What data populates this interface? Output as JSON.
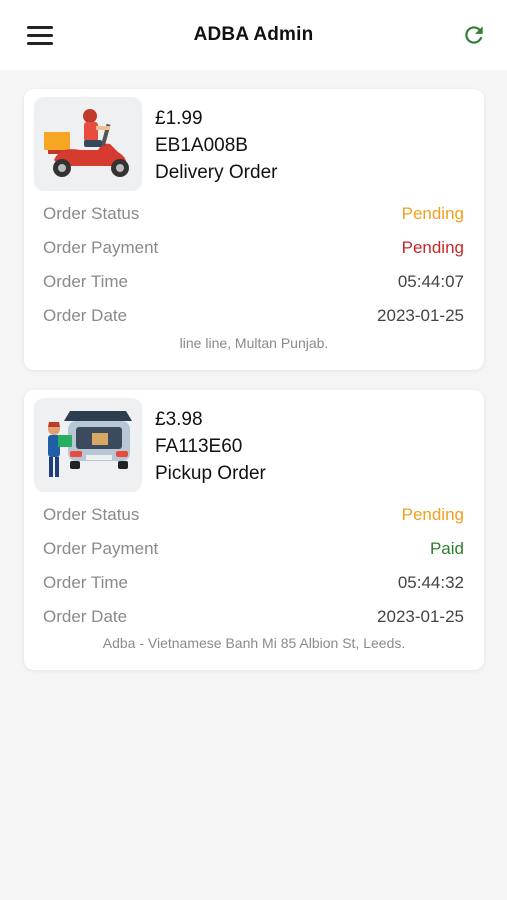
{
  "header": {
    "title": "ADBA Admin",
    "menu_icon": "hamburger-menu-icon",
    "refresh_icon": "refresh-icon",
    "accent_color": "#2e7d32"
  },
  "orders": [
    {
      "price": "£1.99",
      "code": "EB1A008B",
      "type": "Delivery Order",
      "image_icon": "delivery-scooter-icon",
      "rows": {
        "status_label": "Order Status",
        "status_value": "Pending",
        "payment_label": "Order Payment",
        "payment_value": "Pending",
        "time_label": "Order Time",
        "time_value": "05:44:07",
        "date_label": "Order Date",
        "date_value": "2023-01-25"
      },
      "address": "line line, Multan Punjab."
    },
    {
      "price": "£3.98",
      "code": "FA113E60",
      "type": "Pickup Order",
      "image_icon": "pickup-car-icon",
      "rows": {
        "status_label": "Order Status",
        "status_value": "Pending",
        "payment_label": "Order Payment",
        "payment_value": "Paid",
        "time_label": "Order Time",
        "time_value": "05:44:32",
        "date_label": "Order Date",
        "date_value": "2023-01-25"
      },
      "address": "Adba - Vietnamese Banh Mi 85 Albion St, Leeds."
    }
  ],
  "status_colors": {
    "pending": "#f0a020",
    "payment_pending": "#c62828",
    "paid": "#2e7d32"
  }
}
